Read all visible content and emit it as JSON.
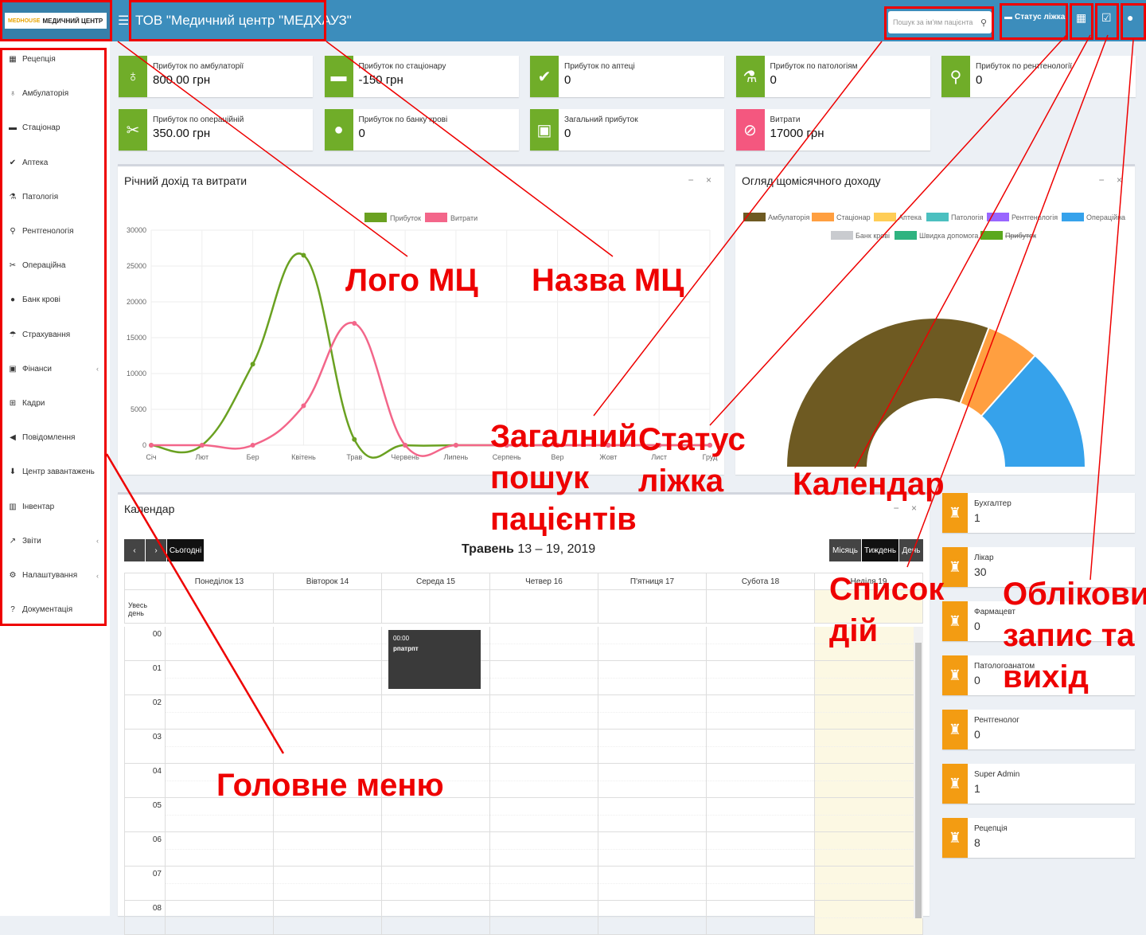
{
  "header": {
    "logo_brand": "MEDHOUSE",
    "logo_text": "МЕДИЧНИЙ ЦЕНТР",
    "clinic_name": "ТОВ \"Медичний центр \"МЕДХАУЗ\"",
    "search_placeholder": "Пошук за ім'ям пацієнта",
    "bed_status_label": "Статус ліжка"
  },
  "sidebar": {
    "items": [
      {
        "label": "Рецепція",
        "icon": "reception-icon",
        "glyph": "▦"
      },
      {
        "label": "Амбулаторія",
        "icon": "stethoscope-icon",
        "glyph": "♁"
      },
      {
        "label": "Стаціонар",
        "icon": "bed-icon",
        "glyph": "▬"
      },
      {
        "label": "Аптека",
        "icon": "mortar-icon",
        "glyph": "✔"
      },
      {
        "label": "Патологія",
        "icon": "flask-icon",
        "glyph": "⚗"
      },
      {
        "label": "Рентгенологія",
        "icon": "microscope-icon",
        "glyph": "⚲"
      },
      {
        "label": "Операційна",
        "icon": "scissors-icon",
        "glyph": "✂"
      },
      {
        "label": "Банк крові",
        "icon": "blood-drop-icon",
        "glyph": "●"
      },
      {
        "label": "Страхування",
        "icon": "umbrella-icon",
        "glyph": "☂"
      },
      {
        "label": "Фінанси",
        "icon": "money-icon",
        "glyph": "▣",
        "has_children": true
      },
      {
        "label": "Кадри",
        "icon": "sitemap-icon",
        "glyph": "⊞"
      },
      {
        "label": "Повідомлення",
        "icon": "bullhorn-icon",
        "glyph": "◀"
      },
      {
        "label": "Центр завантажень",
        "icon": "download-icon",
        "glyph": "⬇"
      },
      {
        "label": "Інвентар",
        "icon": "barcode-icon",
        "glyph": "▥"
      },
      {
        "label": "Звіти",
        "icon": "line-chart-icon",
        "glyph": "↗",
        "has_children": true
      },
      {
        "label": "Налаштування",
        "icon": "cogs-icon",
        "glyph": "⚙",
        "has_children": true
      },
      {
        "label": "Документація",
        "icon": "question-icon",
        "glyph": "?"
      }
    ]
  },
  "stats": [
    {
      "label": "Прибуток по амбулаторії",
      "value": "800.00 грн",
      "icon": "stethoscope-icon",
      "glyph": "♁",
      "color": "#70ad29"
    },
    {
      "label": "Прибуток по стаціонару",
      "value": "-150 грн",
      "icon": "bed-icon",
      "glyph": "▬",
      "color": "#70ad29"
    },
    {
      "label": "Прибуток по аптеці",
      "value": "0",
      "icon": "mortar-icon",
      "glyph": "✔",
      "color": "#70ad29"
    },
    {
      "label": "Прибуток по патологіям",
      "value": "0",
      "icon": "flask-icon",
      "glyph": "⚗",
      "color": "#70ad29"
    },
    {
      "label": "Прибуток по рентгенології",
      "value": "0",
      "icon": "microscope-icon",
      "glyph": "⚲",
      "color": "#70ad29"
    },
    {
      "label": "Прибуток по операційній",
      "value": "350.00 грн",
      "icon": "scissors-icon",
      "glyph": "✂",
      "color": "#70ad29"
    },
    {
      "label": "Прибуток по банку крові",
      "value": "0",
      "icon": "blood-drop-icon",
      "glyph": "●",
      "color": "#70ad29"
    },
    {
      "label": "Загальний прибуток",
      "value": "0",
      "icon": "money-icon",
      "glyph": "▣",
      "color": "#70ad29"
    },
    {
      "label": "Витрати",
      "value": "17000 грн",
      "icon": "no-money-icon",
      "glyph": "⊘",
      "color": "#f4577f"
    }
  ],
  "annual_panel": {
    "title": "Річний дохід та витрати"
  },
  "monthly_panel": {
    "title": "Огляд щомісячного доходу"
  },
  "chart_data": [
    {
      "type": "line",
      "title": "Річний дохід та витрати",
      "categories": [
        "Січ",
        "Лют",
        "Бер",
        "Квітень",
        "Трав",
        "Червень",
        "Липень",
        "Серпень",
        "Вер",
        "Жовт",
        "Лист",
        "Груд"
      ],
      "ylim": [
        0,
        30000
      ],
      "yticks": [
        0,
        5000,
        10000,
        15000,
        20000,
        25000,
        30000
      ],
      "grid": true,
      "legend": "top-center",
      "series": [
        {
          "name": "Прибуток",
          "color": "#6aa121",
          "values": [
            0,
            0,
            11300,
            26500,
            800,
            0,
            0,
            0,
            0,
            0,
            0,
            0
          ]
        },
        {
          "name": "Витрати",
          "color": "#f3668a",
          "values": [
            0,
            0,
            0,
            5500,
            17000,
            0,
            0,
            0,
            0,
            0,
            0,
            0
          ]
        }
      ]
    },
    {
      "type": "pie",
      "title": "Огляд щомісячного доходу",
      "variant": "half-doughnut",
      "legend": "top",
      "categories": [
        "Амбулаторія",
        "Стаціонар",
        "Аптека",
        "Патологія",
        "Рентгенологія",
        "Операційна",
        "Банк крові",
        "Швидка допомога",
        "Прибуток"
      ],
      "colors": [
        "#6e5a22",
        "#ff9f40",
        "#ffcd56",
        "#4bc0c0",
        "#9966ff",
        "#36a2eb",
        "#c9cbcf",
        "#2fb380",
        "#5aa81e"
      ],
      "values": [
        800,
        150,
        0,
        0,
        0,
        350,
        0,
        0,
        0
      ],
      "hidden": [
        "Прибуток"
      ]
    }
  ],
  "calendar": {
    "title": "Календар",
    "today_label": "Сьогодні",
    "range_month": "Травень",
    "range_days": "13 – 19, 2019",
    "view_month": "Місяць",
    "view_week": "Тиждень",
    "view_day": "День",
    "allday_label": "Увесь день",
    "days": [
      "Понеділок 13",
      "Вівторок 14",
      "Середа 15",
      "Четвер 16",
      "П'ятниця 17",
      "Субота 18",
      "Неділя 19"
    ],
    "hours": [
      "00",
      "01",
      "02",
      "03",
      "04",
      "05",
      "06",
      "07",
      "08"
    ],
    "event": {
      "time": "00:00",
      "title": "рпатрпт"
    }
  },
  "roles": [
    {
      "label": "Бухгалтер",
      "value": "1"
    },
    {
      "label": "Лікар",
      "value": "30"
    },
    {
      "label": "Фармацевт",
      "value": "0"
    },
    {
      "label": "Патологоанатом",
      "value": "0"
    },
    {
      "label": "Рентгенолог",
      "value": "0"
    },
    {
      "label": "Super Admin",
      "value": "1"
    },
    {
      "label": "Рецепція",
      "value": "8"
    }
  ],
  "annotations": {
    "logo": "Лого МЦ",
    "name": "Назва МЦ",
    "search": "Загалний пошук пацієнтів",
    "bed_status": "Статус ліжка",
    "calendar": "Календар",
    "activity": "Список дій",
    "account": "Обліковий запис та вихід",
    "menu": "Головне меню"
  },
  "colors": {
    "topbar": "#3c8dbc",
    "annotation": "#ee0000",
    "role_icon": "#f39c12"
  }
}
